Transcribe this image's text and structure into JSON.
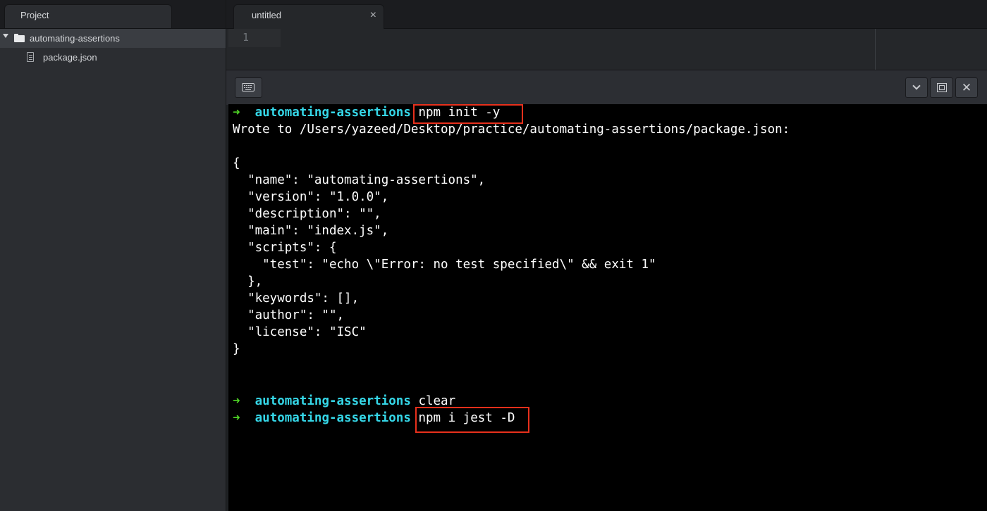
{
  "sidebar": {
    "tab_title": "Project",
    "folder": {
      "name": "automating-assertions",
      "icon": "folder-icon"
    },
    "files": [
      {
        "name": "package.json",
        "icon": "file-icon"
      }
    ]
  },
  "editor": {
    "tab_title": "untitled",
    "close_glyph": "×",
    "line_number": "1"
  },
  "terminal_toolbar": {
    "keyboard_icon": "keyboard-icon",
    "collapse_icon": "chevron-down-icon",
    "maximize_icon": "maximize-icon",
    "close_glyph": "✕"
  },
  "terminal": {
    "prompt_arrow": "➜",
    "prompt_dir": "automating-assertions",
    "commands": [
      "npm init -y",
      "clear",
      "npm i jest -D"
    ],
    "output": [
      "Wrote to /Users/yazeed/Desktop/practice/automating-assertions/package.json:",
      "",
      "{",
      "  \"name\": \"automating-assertions\",",
      "  \"version\": \"1.0.0\",",
      "  \"description\": \"\",",
      "  \"main\": \"index.js\",",
      "  \"scripts\": {",
      "    \"test\": \"echo \\\"Error: no test specified\\\" && exit 1\"",
      "  },",
      "  \"keywords\": [],",
      "  \"author\": \"\",",
      "  \"license\": \"ISC\"",
      "}"
    ],
    "colors": {
      "arrow": "#4fd626",
      "dir": "#35d7e8",
      "highlight": "#e8301c",
      "text": "#ffffff"
    }
  }
}
